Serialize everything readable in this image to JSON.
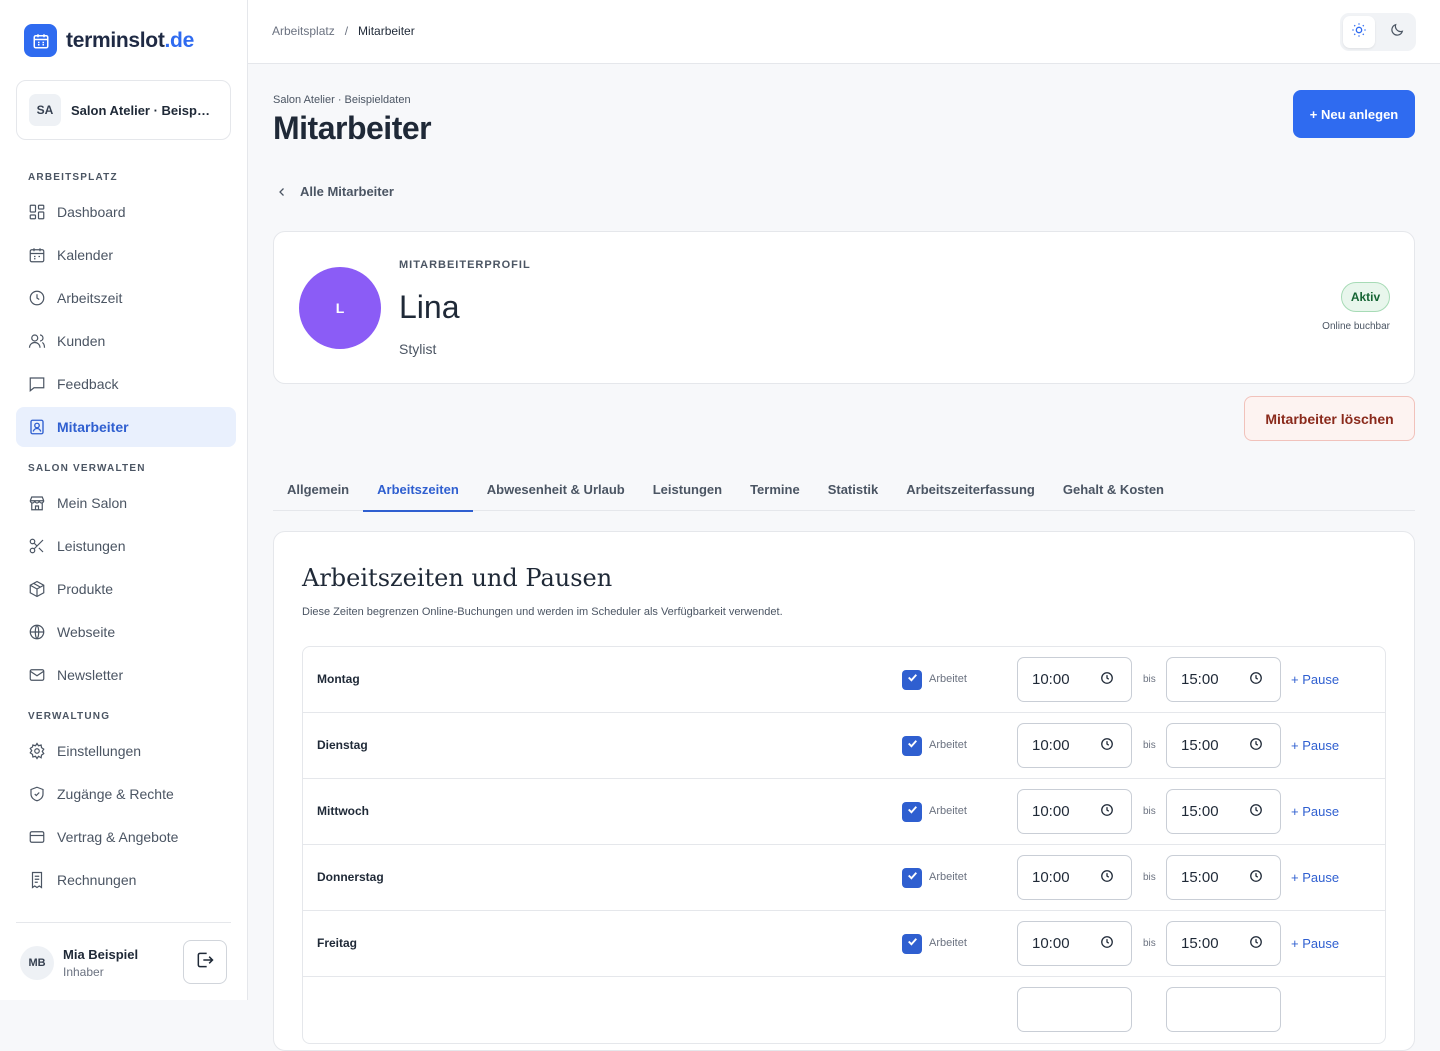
{
  "brand": {
    "name": "terminslot",
    "tld": ".de",
    "accent": "#2f6bf0"
  },
  "salon_selector": {
    "initials": "SA",
    "name": "Salon Atelier · Beispiel..."
  },
  "nav": {
    "sections": [
      "ARBEITSPLATZ",
      "SALON VERWALTEN",
      "VERWALTUNG"
    ],
    "items": [
      {
        "label": "Dashboard",
        "icon": "grid-icon"
      },
      {
        "label": "Kalender",
        "icon": "calendar-icon"
      },
      {
        "label": "Arbeitszeit",
        "icon": "clock-icon"
      },
      {
        "label": "Kunden",
        "icon": "users-icon"
      },
      {
        "label": "Feedback",
        "icon": "message-icon"
      },
      {
        "label": "Mitarbeiter",
        "icon": "badge-icon",
        "active": true
      },
      {
        "label": "Mein Salon",
        "icon": "store-icon"
      },
      {
        "label": "Leistungen",
        "icon": "scissors-icon"
      },
      {
        "label": "Produkte",
        "icon": "box-icon"
      },
      {
        "label": "Webseite",
        "icon": "globe-icon"
      },
      {
        "label": "Newsletter",
        "icon": "mail-icon"
      },
      {
        "label": "Einstellungen",
        "icon": "gear-icon"
      },
      {
        "label": "Zugänge & Rechte",
        "icon": "shield-icon"
      },
      {
        "label": "Vertrag & Angebote",
        "icon": "card-icon"
      },
      {
        "label": "Rechnungen",
        "icon": "receipt-icon"
      }
    ]
  },
  "user": {
    "initials": "MB",
    "name": "Mia Beispiel",
    "role": "Inhaber"
  },
  "breadcrumb": {
    "parent": "Arbeitsplatz",
    "sep": "/",
    "current": "Mitarbeiter"
  },
  "header": {
    "eyebrow": "Salon Atelier · Beispieldaten",
    "title": "Mitarbeiter",
    "new_button": "+ Neu anlegen"
  },
  "back_link": "Alle Mitarbeiter",
  "profile": {
    "label": "MITARBEITERPROFIL",
    "initial": "L",
    "name": "Lina",
    "role": "Stylist",
    "status": "Aktiv",
    "online_note": "Online buchbar",
    "avatar_color": "#8b5cf6"
  },
  "delete_button": "Mitarbeiter löschen",
  "tabs": [
    "Allgemein",
    "Arbeitszeiten",
    "Abwesenheit & Urlaub",
    "Leistungen",
    "Termine",
    "Statistik",
    "Arbeitszeiterfassung",
    "Gehalt & Kosten"
  ],
  "active_tab": "Arbeitszeiten",
  "hours": {
    "title": "Arbeitszeiten und Pausen",
    "description": "Diese Zeiten begrenzen Online-Buchungen und werden im Scheduler als Verfügbarkeit verwendet.",
    "works_label": "Arbeitet",
    "bis_label": "bis",
    "pause_label": "+ Pause",
    "days": [
      {
        "name": "Montag",
        "from": "10:00",
        "to": "15:00",
        "works": true
      },
      {
        "name": "Dienstag",
        "from": "10:00",
        "to": "15:00",
        "works": true
      },
      {
        "name": "Mittwoch",
        "from": "10:00",
        "to": "15:00",
        "works": true
      },
      {
        "name": "Donnerstag",
        "from": "10:00",
        "to": "15:00",
        "works": true
      },
      {
        "name": "Freitag",
        "from": "10:00",
        "to": "15:00",
        "works": true
      }
    ]
  }
}
